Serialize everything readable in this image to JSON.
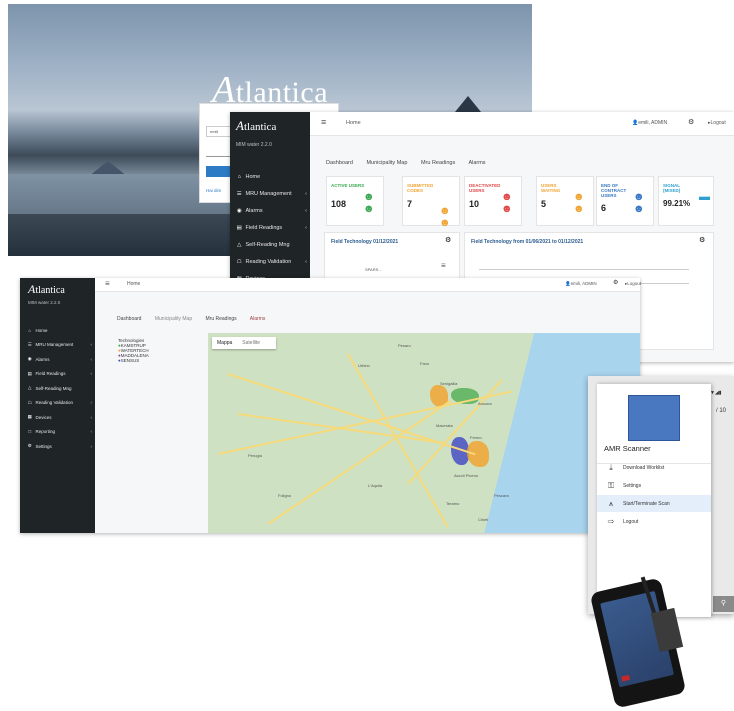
{
  "brand": {
    "logo_initial": "A",
    "logo_rest": "tlantica"
  },
  "login": {
    "username_value": "emili",
    "forgot_link": "Hai dim"
  },
  "window_back": {
    "version": "MIM water 2.2.0",
    "breadcrumb": "Home",
    "user": "emili, ADMIN",
    "logout": "Logout",
    "menu": [
      {
        "label": "Home",
        "icon": "home-icon"
      },
      {
        "label": "MRU Management",
        "icon": "sitemap-icon"
      },
      {
        "label": "Alarms",
        "icon": "alarm-icon"
      },
      {
        "label": "Field Readings",
        "icon": "readings-icon"
      },
      {
        "label": "Self-Reading Mng",
        "icon": "car-icon"
      },
      {
        "label": "Reading Validation",
        "icon": "bank-icon"
      },
      {
        "label": "Devices",
        "icon": "devices-icon"
      }
    ],
    "tabs": [
      "Dashboard",
      "Municipality Map",
      "Mru Readings",
      "Alarms"
    ],
    "kpis": [
      {
        "label": "ACTIVE USERS",
        "value": "108",
        "color": "#3aa852"
      },
      {
        "label": "SUBMITTED CODES",
        "value": "7",
        "color": "#f0a433"
      },
      {
        "label": "DEACTIVATED USERS",
        "value": "10",
        "color": "#e04646"
      },
      {
        "label": "USERS WAITING",
        "value": "5",
        "color": "#f0a433"
      },
      {
        "label": "END OF CONTRACT USERS",
        "value": "6",
        "color": "#3577c4"
      },
      {
        "label": "SIGNAL (MIXED)",
        "value": "99.21%",
        "color": "#2e9fcf"
      }
    ],
    "panel1_title": "Field Technology 01/12/2021",
    "panel2_title": "Field Technology from 01/06/2021 to 01/12/2021",
    "panel1_sub": "SPARS..."
  },
  "window_front": {
    "version": "MIM water 2.2.0",
    "breadcrumb": "Home",
    "user": "emili, ADMIN",
    "logout": "Logout",
    "menu": [
      {
        "label": "Home",
        "icon": "home-icon"
      },
      {
        "label": "MRU Management",
        "icon": "sitemap-icon"
      },
      {
        "label": "Alarms",
        "icon": "alarm-icon"
      },
      {
        "label": "Field Readings",
        "icon": "readings-icon"
      },
      {
        "label": "Self-Reading Mng",
        "icon": "car-icon"
      },
      {
        "label": "Reading Validation",
        "icon": "bank-icon"
      },
      {
        "label": "Devices",
        "icon": "devices-icon"
      },
      {
        "label": "Reporting",
        "icon": "file-icon"
      },
      {
        "label": "Settings",
        "icon": "gear-icon"
      }
    ],
    "tabs": [
      "Dashboard",
      "Municipality Map",
      "Mru Readings",
      "Alarms"
    ],
    "legend_title": "Technologies",
    "legend": [
      {
        "label": "KAMSTRUP",
        "color": "#3aa852"
      },
      {
        "label": "WATERTECH",
        "color": "#f0a433"
      },
      {
        "label": "MADDALENA",
        "color": "#8e3fa8"
      },
      {
        "label": "SENSUS",
        "color": "#3b4bd0"
      }
    ],
    "map_tabs": [
      "Mappa",
      "Satellite"
    ],
    "places": [
      "Pesaro",
      "Fano",
      "Senigallia",
      "Ancona",
      "Macerata",
      "Fermo",
      "Ascoli Piceno",
      "Teramo",
      "Pescara",
      "Chieti",
      "L'Aquila",
      "Perugia",
      "Foligno",
      "Urbino"
    ]
  },
  "phone": {
    "title": "AMR Scanner",
    "items": [
      {
        "label": "Download Worklist",
        "icon": "download-icon"
      },
      {
        "label": "Settings",
        "icon": "key-icon"
      },
      {
        "label": "Start/Terminate Scan",
        "icon": "antenna-icon"
      },
      {
        "label": "Logout",
        "icon": "logout-arrow-icon"
      }
    ],
    "page_fraction": "/ 10"
  }
}
